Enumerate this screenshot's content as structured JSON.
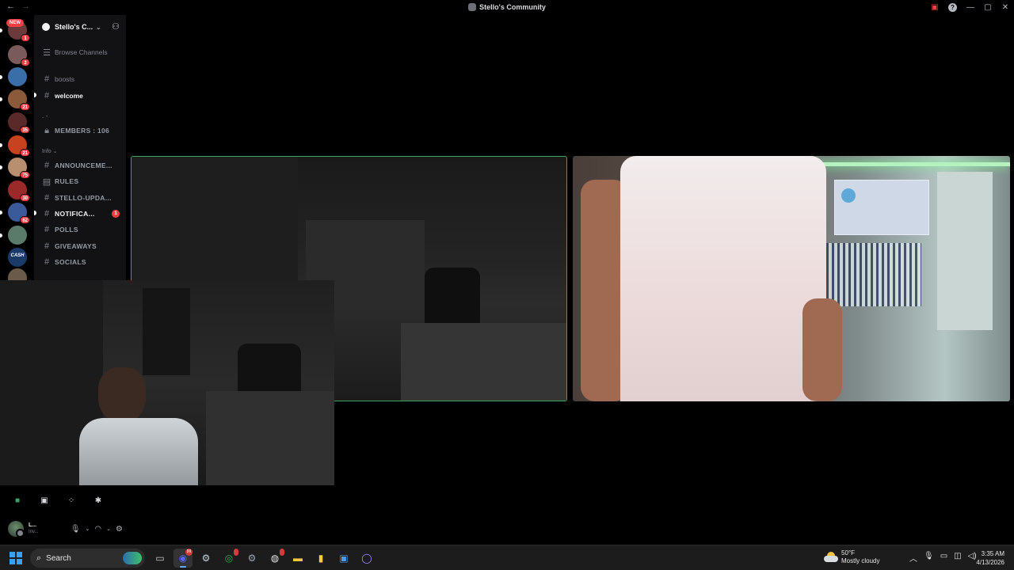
{
  "window": {
    "title": "Stello's Community",
    "nav_back": "←",
    "nav_forward": "→",
    "help_glyph": "?",
    "win_minimize": "—",
    "win_maximize": "▢",
    "win_close": "✕"
  },
  "servers": {
    "new_label": "NEW",
    "items": [
      {
        "badge": "1",
        "color": "#6b3a3a"
      },
      {
        "badge": "2",
        "color": "#7a5a5a"
      },
      {
        "badge": "",
        "color": "#3a6ea8"
      },
      {
        "badge": "21",
        "color": "#8a5a3a"
      },
      {
        "badge": "35",
        "color": "#5a2a2a"
      },
      {
        "badge": "21",
        "color": "#c8421f"
      },
      {
        "badge": "75",
        "color": "#b89070"
      },
      {
        "badge": "30",
        "color": "#9a2a2a"
      },
      {
        "badge": "62",
        "color": "#3a5a9a"
      },
      {
        "badge": "",
        "color": "#5a7a6a"
      },
      {
        "badge": "",
        "color": "#1a3a6a",
        "label": "CASH"
      },
      {
        "badge": "",
        "color": "#6a5a4a"
      }
    ]
  },
  "guild": {
    "name": "Stello's C...",
    "browse_channels": "Browse Channels",
    "channels_top": [
      {
        "name": "boosts",
        "bold": false
      },
      {
        "name": "welcome",
        "bold": true
      }
    ],
    "separator": ". -",
    "members_channel": "MEMBERS : 106",
    "category": "Info",
    "channels_info": [
      {
        "name": "ANNOUNCEME...",
        "icon": "#",
        "bold": false
      },
      {
        "name": "RULES",
        "icon": "rules",
        "bold": false
      },
      {
        "name": "STELLO-UPDA...",
        "icon": "#",
        "bold": false
      },
      {
        "name": "NOTIFICA...",
        "icon": "#",
        "bold": true,
        "mention": "1"
      },
      {
        "name": "POLLS",
        "icon": "#",
        "bold": false
      },
      {
        "name": "GIVEAWAYS",
        "icon": "#",
        "bold": false
      },
      {
        "name": "SOCIALS",
        "icon": "#",
        "bold": false
      }
    ]
  },
  "user": {
    "name": "L...",
    "status": "Inv..."
  },
  "taskbar": {
    "search_placeholder": "Search",
    "apps": [
      {
        "name": "task-view",
        "glyph": "▭"
      },
      {
        "name": "discord",
        "glyph": "◉",
        "active": true,
        "badge": "99"
      },
      {
        "name": "steam",
        "glyph": "⚙"
      },
      {
        "name": "chrome",
        "glyph": "◎",
        "badge": ""
      },
      {
        "name": "settings",
        "glyph": "⚙"
      },
      {
        "name": "obs",
        "glyph": "◍",
        "badge": ""
      },
      {
        "name": "file-explorer",
        "glyph": "▬"
      },
      {
        "name": "sticky-notes",
        "glyph": "▮"
      },
      {
        "name": "store",
        "glyph": "▣"
      },
      {
        "name": "cortana",
        "glyph": "◯"
      }
    ],
    "weather_temp": "50°F",
    "weather_desc": "Mostly cloudy",
    "time": "3:35 AM",
    "date": "4/13/2026"
  }
}
